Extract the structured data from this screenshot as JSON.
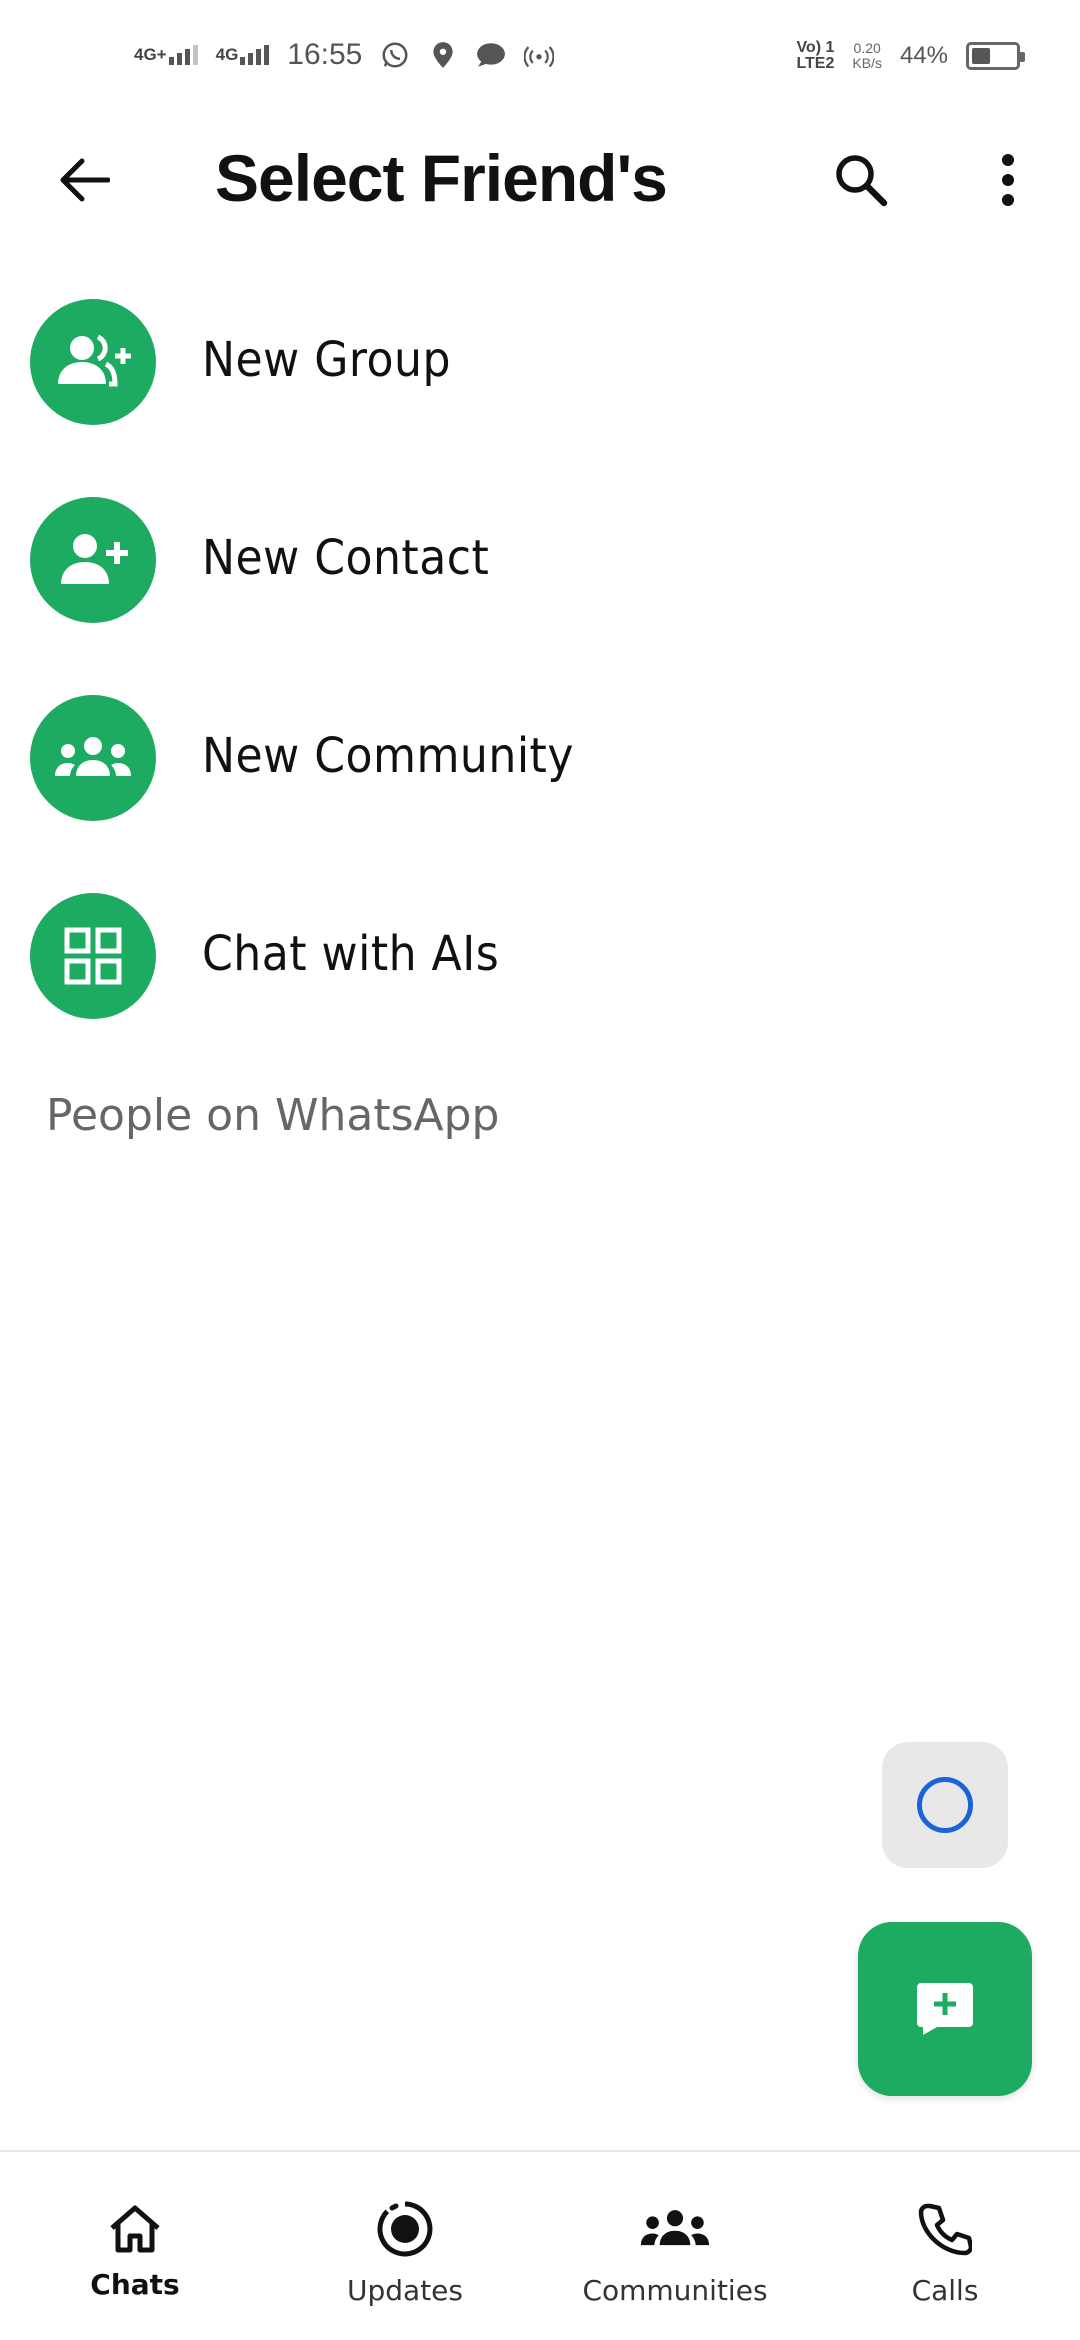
{
  "status_bar": {
    "network1": "4G+",
    "network2": "4G",
    "time": "16:55",
    "volte": "Vo) 1",
    "lte": "LTE2",
    "speed_value": "0.20",
    "speed_unit": "KB/s",
    "battery_percent": "44%",
    "battery_level": 0.44,
    "icons": [
      "whatsapp-icon",
      "location-pin-icon",
      "message-bubble-icon",
      "hotspot-icon"
    ]
  },
  "app_bar": {
    "title": "Select Friend's",
    "back_icon": "arrow-back-icon",
    "search_icon": "search-icon",
    "more_icon": "more-vert-icon"
  },
  "actions": [
    {
      "label": "New Group",
      "icon": "group-add-icon"
    },
    {
      "label": "New Contact",
      "icon": "person-add-icon"
    },
    {
      "label": "New Community",
      "icon": "community-icon"
    },
    {
      "label": "Chat with AIs",
      "icon": "grid-icon"
    }
  ],
  "section_header": "People on WhatsApp",
  "bottom_nav": [
    {
      "label": "Chats",
      "icon": "home-icon",
      "active": true
    },
    {
      "label": "Updates",
      "icon": "status-icon",
      "active": false
    },
    {
      "label": "Communities",
      "icon": "communities-icon",
      "active": false
    },
    {
      "label": "Calls",
      "icon": "phone-icon",
      "active": false
    }
  ],
  "colors": {
    "accent": "#1daa61",
    "assistant_ring": "#1a63d8",
    "assistant_bg": "#e8e8e8"
  }
}
